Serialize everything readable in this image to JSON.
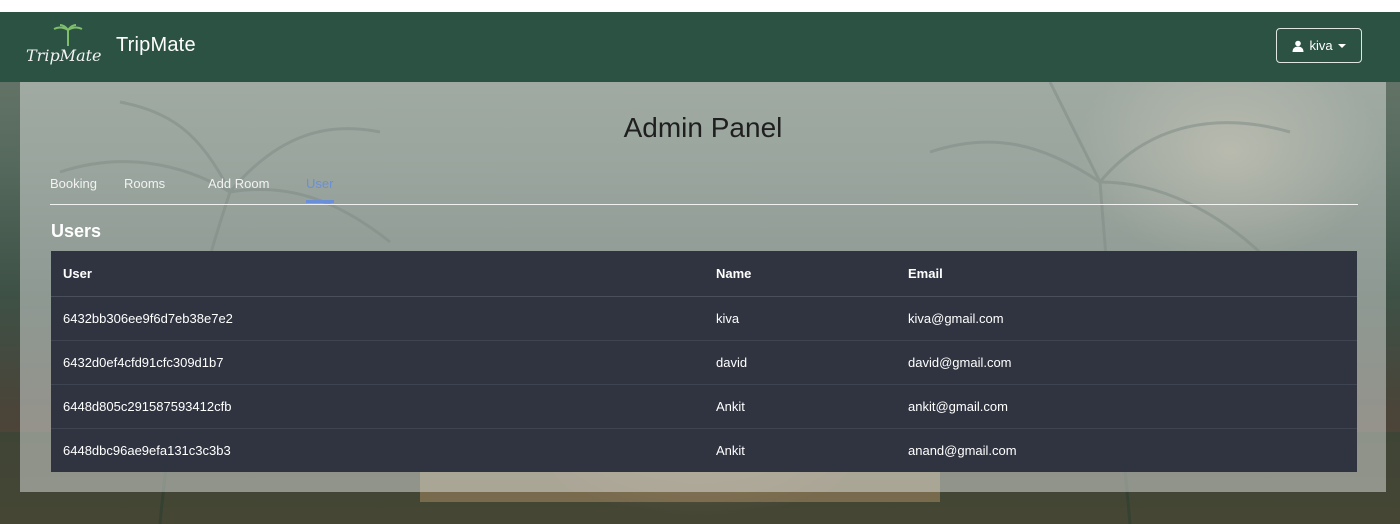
{
  "navbar": {
    "logo_text": "TripMate",
    "brand": "TripMate",
    "user_label": "kiva"
  },
  "panel": {
    "title": "Admin Panel",
    "tabs": [
      {
        "label": "Booking",
        "active": false
      },
      {
        "label": "Rooms",
        "active": false
      },
      {
        "label": "Add Room",
        "active": false
      },
      {
        "label": "User",
        "active": true
      }
    ]
  },
  "users": {
    "title": "Users",
    "columns": [
      "User",
      "Name",
      "Email"
    ],
    "rows": [
      {
        "user": "6432bb306ee9f6d7eb38e7e2",
        "name": "kiva",
        "email": "kiva@gmail.com"
      },
      {
        "user": "6432d0ef4cfd91cfc309d1b7",
        "name": "david",
        "email": "david@gmail.com"
      },
      {
        "user": "6448d805c291587593412cfb",
        "name": "Ankit",
        "email": "ankit@gmail.com"
      },
      {
        "user": "6448dbc96ae9efa131c3c3b3",
        "name": "Ankit",
        "email": "anand@gmail.com"
      }
    ]
  },
  "colors": {
    "navbar": "#2c5244",
    "table": "#303440",
    "active_tab": "#6a8fd9"
  },
  "icons": {
    "user": "user-icon",
    "caret": "caret-down-icon"
  }
}
